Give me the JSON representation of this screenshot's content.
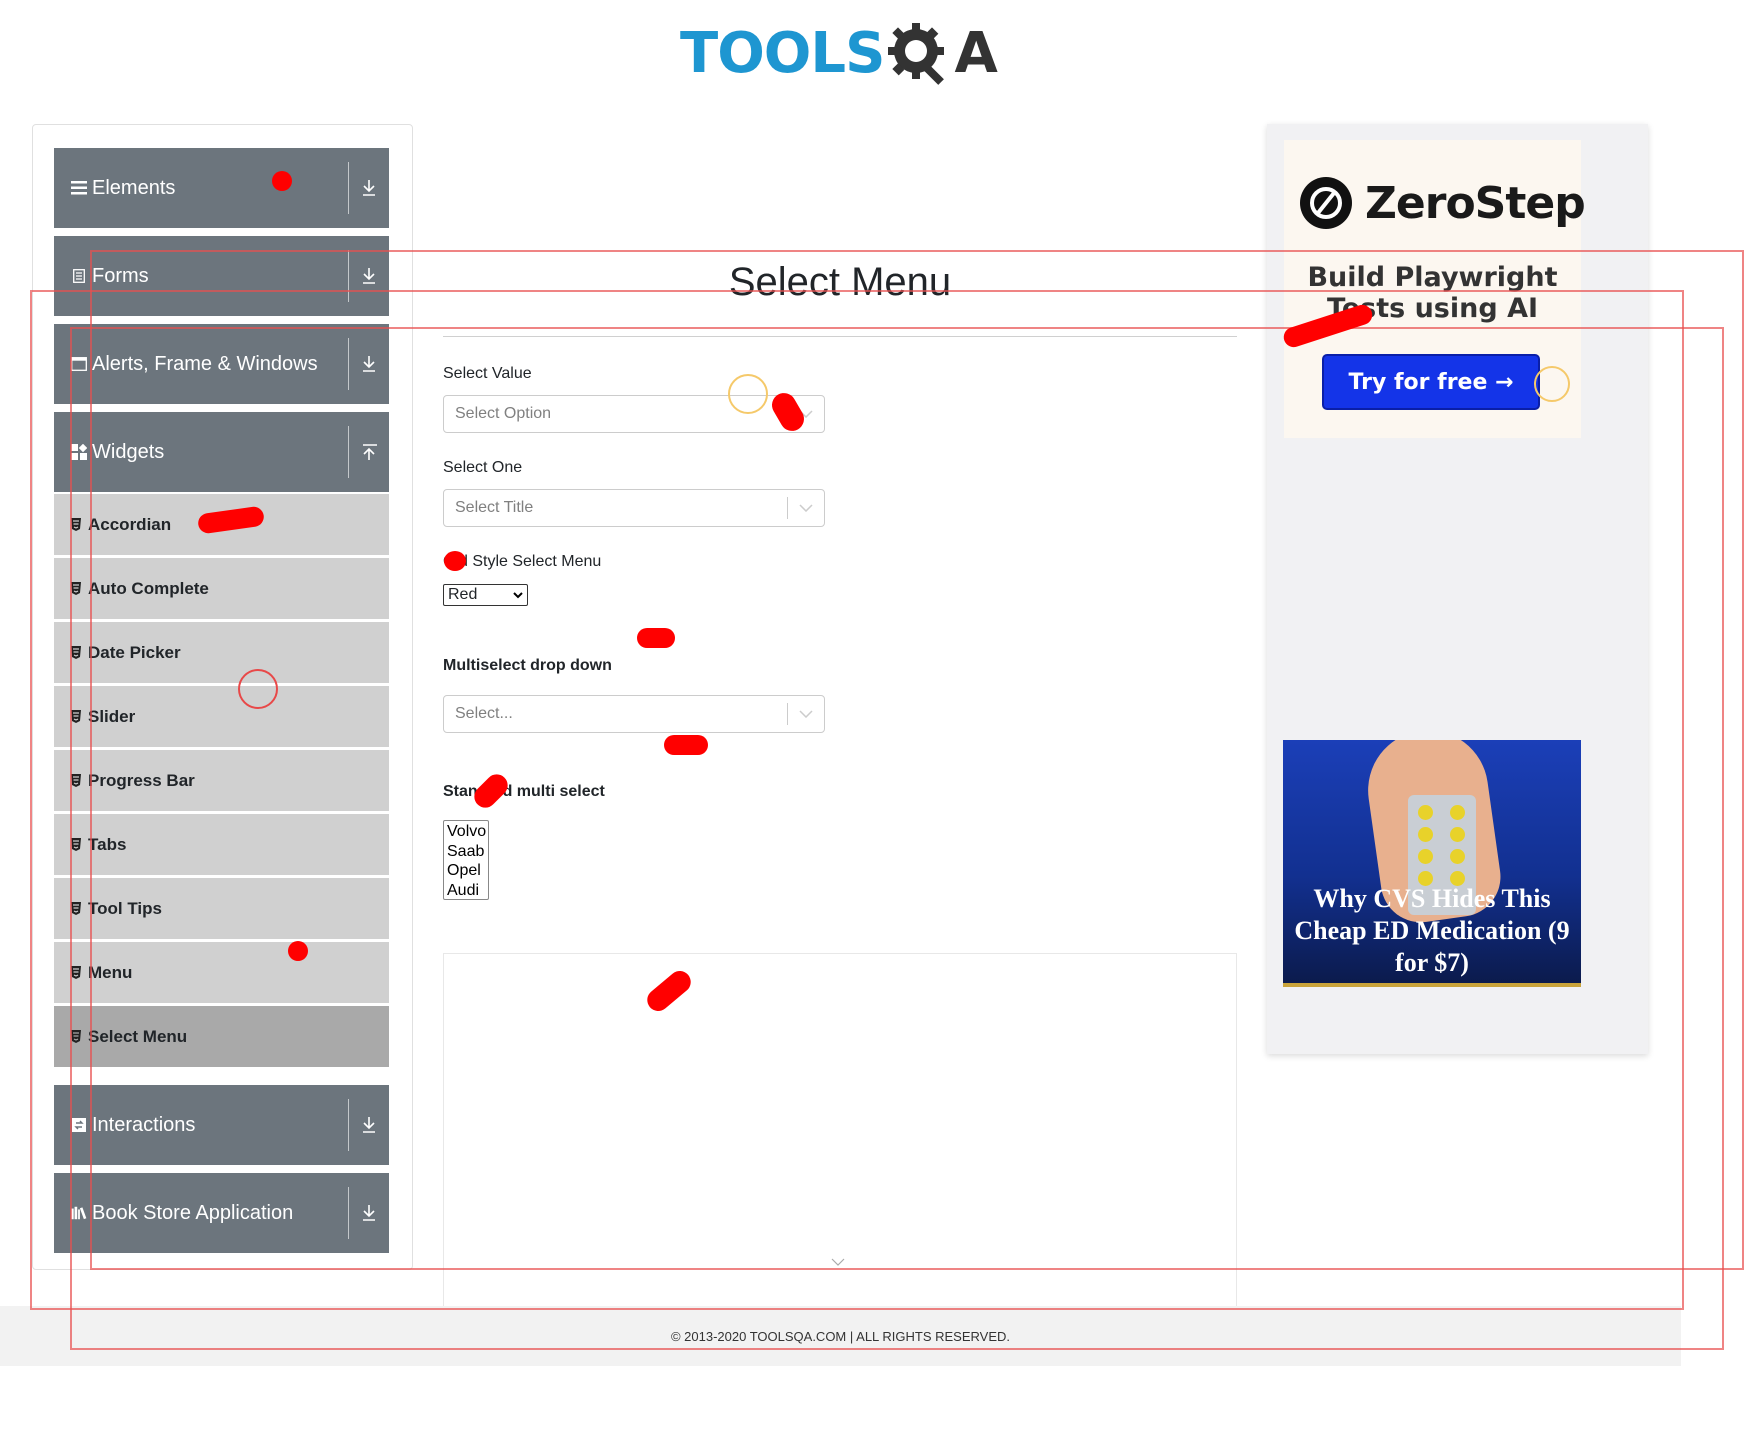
{
  "logo": {
    "left": "TOOLS",
    "right": "A"
  },
  "sidebar": {
    "groups": [
      {
        "label": "Elements",
        "icon": "hamburger-icon"
      },
      {
        "label": "Forms",
        "icon": "document-icon"
      },
      {
        "label": "Alerts, Frame & Windows",
        "icon": "window-icon"
      },
      {
        "label": "Widgets",
        "icon": "widgets-icon",
        "expanded": true
      },
      {
        "label": "Interactions",
        "icon": "interactions-icon"
      },
      {
        "label": "Book Store Application",
        "icon": "books-icon"
      }
    ],
    "widget_items": [
      {
        "label": "Accordian"
      },
      {
        "label": "Auto Complete"
      },
      {
        "label": "Date Picker"
      },
      {
        "label": "Slider"
      },
      {
        "label": "Progress Bar"
      },
      {
        "label": "Tabs"
      },
      {
        "label": "Tool Tips"
      },
      {
        "label": "Menu"
      },
      {
        "label": "Select Menu",
        "active": true
      }
    ]
  },
  "main": {
    "title": "Select Menu",
    "select_value": {
      "label": "Select Value",
      "placeholder": "Select Option"
    },
    "select_one": {
      "label": "Select One",
      "placeholder": "Select Title"
    },
    "old_style": {
      "label": "Old Style Select Menu",
      "value": "Red"
    },
    "multiselect": {
      "label": "Multiselect drop down",
      "placeholder": "Select..."
    },
    "standard_multi": {
      "label": "Standard multi select",
      "options": [
        "Volvo",
        "Saab",
        "Opel",
        "Audi"
      ]
    }
  },
  "ad": {
    "brand": "ZeroStep",
    "tagline_line1": "Build Playwright",
    "tagline_line2": "Tests using AI",
    "cta": "Try for free →",
    "promo_line1": "Why CVS Hides This",
    "promo_line2": "Cheap ED Medication (9",
    "promo_line3": "for $7)"
  },
  "footer": {
    "text": "© 2013-2020 TOOLSQA.COM | ALL RIGHTS RESERVED."
  },
  "colors": {
    "sidebar_group": "#6c757d",
    "sidebar_item": "#d0d0d0",
    "sidebar_active": "#a9a9a9",
    "logo_blue": "#1e96d1",
    "cta_blue": "#1434e8"
  }
}
